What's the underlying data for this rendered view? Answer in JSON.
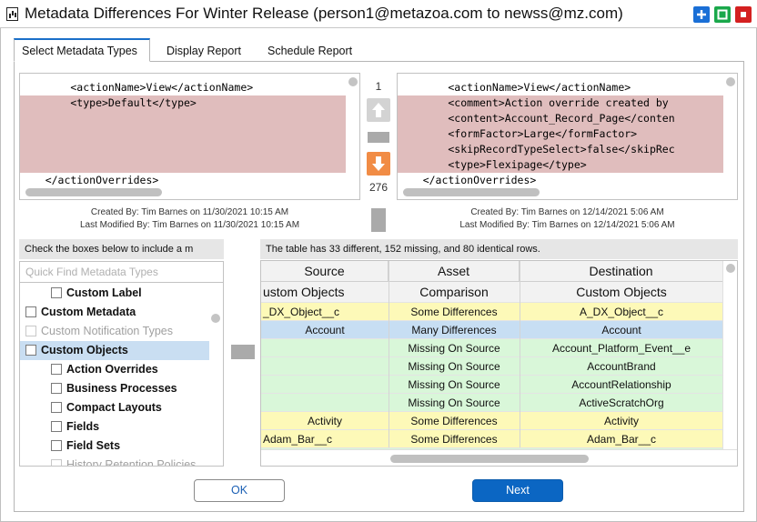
{
  "window": {
    "title": "Metadata Differences For Winter Release (person1@metazoa.com to newss@mz.com)",
    "icons": [
      "chart-icon",
      "maximize-icon",
      "restore-icon",
      "close-icon"
    ],
    "colors": {
      "maximize": "#1a6fd6",
      "restore": "#1aa84b",
      "close": "#d42020"
    }
  },
  "tabs": [
    {
      "label": "Select Metadata Types",
      "active": true
    },
    {
      "label": "Display Report",
      "active": false
    },
    {
      "label": "Schedule Report",
      "active": false
    }
  ],
  "xml_left": {
    "lines": [
      {
        "text": "        <actionName>View</actionName>",
        "diff": false
      },
      {
        "text": "        <type>Default</type>",
        "diff": true
      },
      {
        "text": "",
        "diff": true
      },
      {
        "text": "",
        "diff": true
      },
      {
        "text": "",
        "diff": true
      },
      {
        "text": "",
        "diff": true
      },
      {
        "text": "    </actionOverrides>",
        "diff": false
      }
    ],
    "created": "Created By: Tim Barnes on 11/30/2021 10:15 AM",
    "modified": "Last Modified By: Tim Barnes on 11/30/2021 10:15 AM"
  },
  "xml_right": {
    "lines": [
      {
        "text": "        <actionName>View</actionName>",
        "diff": false
      },
      {
        "text": "        <comment>Action override created by",
        "diff": true
      },
      {
        "text": "        <content>Account_Record_Page</conten",
        "diff": true
      },
      {
        "text": "        <formFactor>Large</formFactor>",
        "diff": true
      },
      {
        "text": "        <skipRecordTypeSelect>false</skipRec",
        "diff": true
      },
      {
        "text": "        <type>Flexipage</type>",
        "diff": true
      },
      {
        "text": "    </actionOverrides>",
        "diff": false
      }
    ],
    "created": "Created By: Tim Barnes on 12/14/2021 5:06 AM",
    "modified": "Last Modified By: Tim Barnes on 12/14/2021 5:06 AM"
  },
  "diff_nav": {
    "current": "1",
    "total": "276",
    "icons": [
      "arrow-up-icon",
      "arrow-down-icon"
    ],
    "colors": {
      "prev": "#d3d3d3",
      "next": "#f18c45"
    }
  },
  "metadata_types": {
    "header": "Check the boxes below to include a m",
    "search_placeholder": "Quick Find Metadata Types",
    "items": [
      {
        "label": "Custom Label",
        "indent": 1,
        "bold": true,
        "disabled": false,
        "selected": false
      },
      {
        "label": "Custom Metadata",
        "indent": 0,
        "bold": true,
        "disabled": false,
        "selected": false
      },
      {
        "label": "Custom Notification Types",
        "indent": 0,
        "bold": false,
        "disabled": true,
        "selected": false
      },
      {
        "label": "Custom Objects",
        "indent": 0,
        "bold": true,
        "disabled": false,
        "selected": true
      },
      {
        "label": "Action Overrides",
        "indent": 1,
        "bold": true,
        "disabled": false,
        "selected": false
      },
      {
        "label": "Business Processes",
        "indent": 1,
        "bold": true,
        "disabled": false,
        "selected": false
      },
      {
        "label": "Compact Layouts",
        "indent": 1,
        "bold": true,
        "disabled": false,
        "selected": false
      },
      {
        "label": "Fields",
        "indent": 1,
        "bold": true,
        "disabled": false,
        "selected": false
      },
      {
        "label": "Field Sets",
        "indent": 1,
        "bold": true,
        "disabled": false,
        "selected": false
      },
      {
        "label": "History Retention Policies",
        "indent": 1,
        "bold": false,
        "disabled": true,
        "selected": false
      }
    ]
  },
  "comparison": {
    "summary": "The table has 33 different, 152 missing, and 80 identical rows.",
    "columns": [
      "Source",
      "Asset",
      "Destination"
    ],
    "subheader": [
      "ustom Objects",
      "Comparison",
      "Custom Objects"
    ],
    "rows": [
      {
        "source": "_DX_Object__c",
        "asset": "Some Differences",
        "destination": "A_DX_Object__c",
        "status": "some"
      },
      {
        "source": "Account",
        "asset": "Many Differences",
        "destination": "Account",
        "status": "many"
      },
      {
        "source": "",
        "asset": "Missing On Source",
        "destination": "Account_Platform_Event__e",
        "status": "missing"
      },
      {
        "source": "",
        "asset": "Missing On Source",
        "destination": "AccountBrand",
        "status": "missing"
      },
      {
        "source": "",
        "asset": "Missing On Source",
        "destination": "AccountRelationship",
        "status": "missing"
      },
      {
        "source": "",
        "asset": "Missing On Source",
        "destination": "ActiveScratchOrg",
        "status": "missing"
      },
      {
        "source": "Activity",
        "asset": "Some Differences",
        "destination": "Activity",
        "status": "some"
      },
      {
        "source": "Adam_Bar__c",
        "asset": "Some Differences",
        "destination": "Adam_Bar__c",
        "status": "some"
      },
      {
        "source": "",
        "asset": "",
        "destination": "",
        "status": "missing"
      }
    ],
    "row_colors": {
      "some": "#fdf9b8",
      "many": "#c7def3",
      "missing": "#d9f7d9"
    }
  },
  "footer": {
    "ok_label": "OK",
    "next_label": "Next"
  }
}
